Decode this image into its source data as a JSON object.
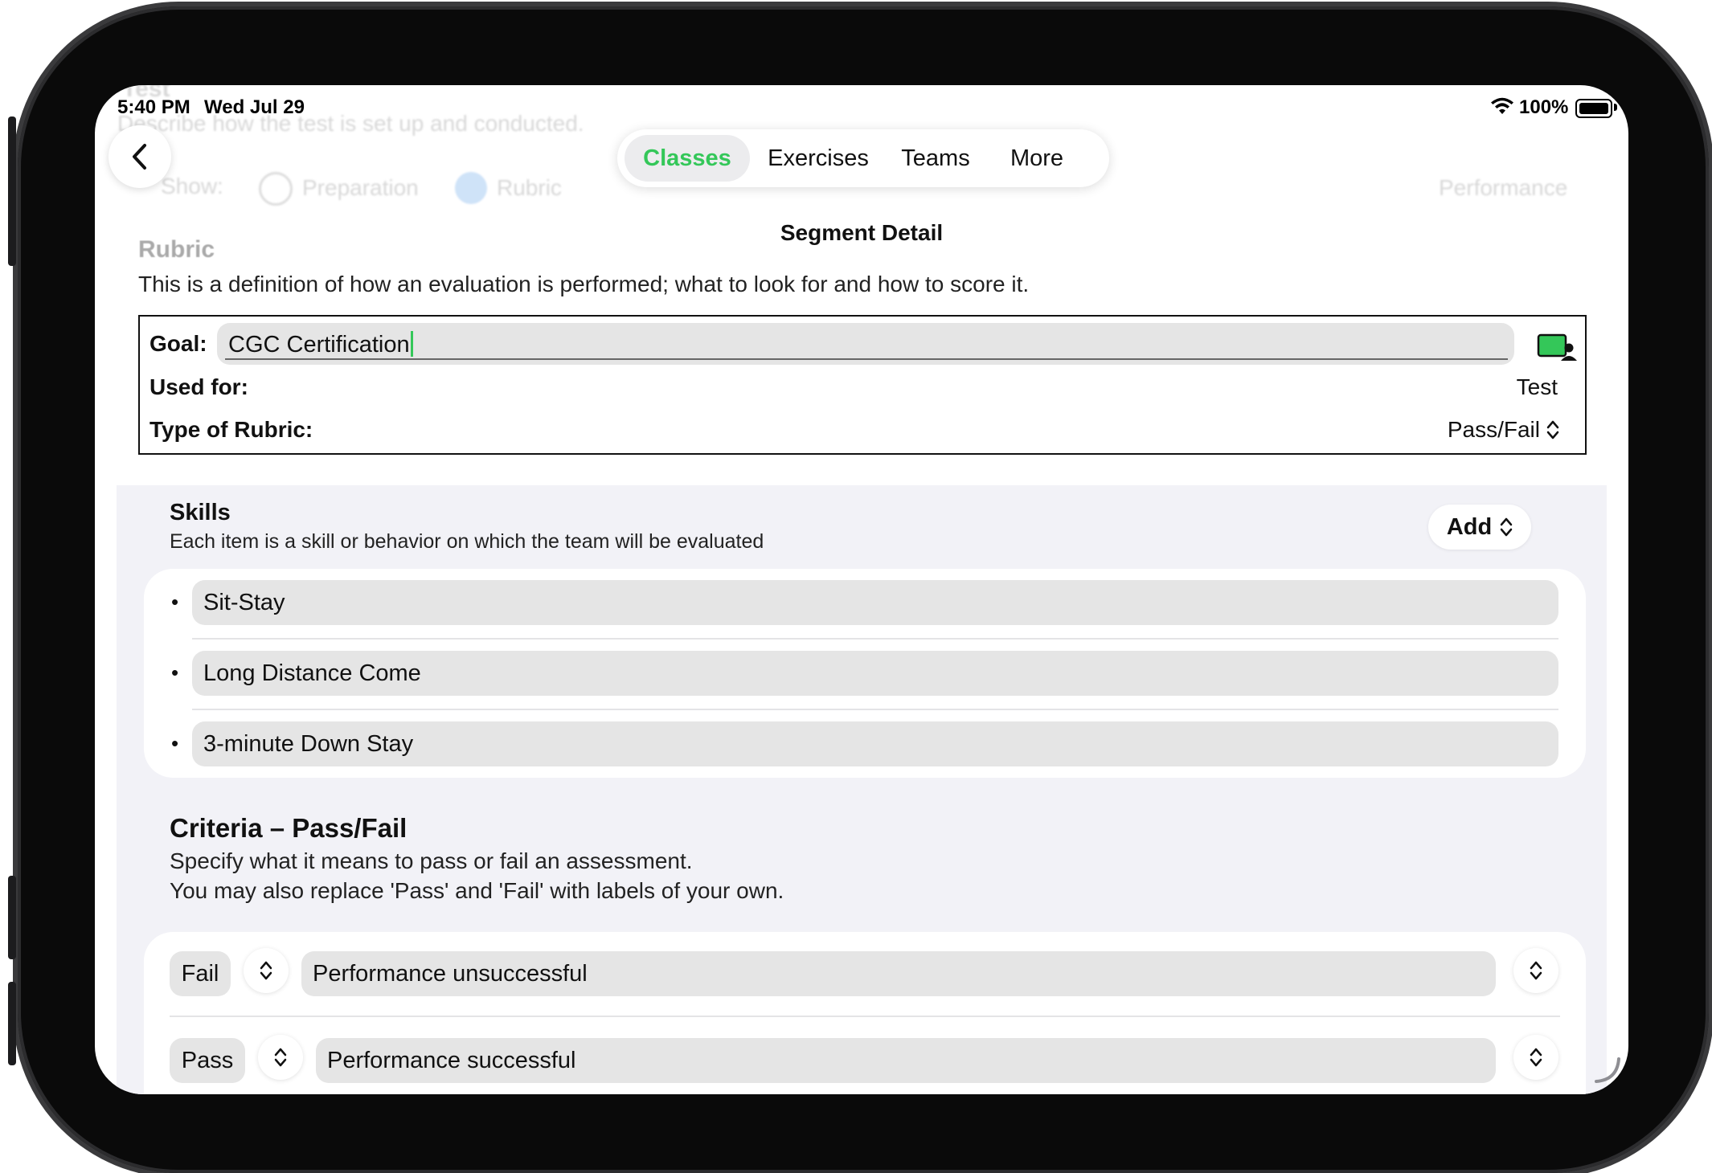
{
  "status_bar": {
    "time": "5:40 PM",
    "date": "Wed Jul 29",
    "battery": "100%",
    "wifi_icon": "wifi-icon",
    "battery_icon": "battery-icon"
  },
  "background_ghost": {
    "heading": "Test",
    "subheading": "Describe how the test is set up and conducted.",
    "show_label": "Show:",
    "option_preparation": "Preparation",
    "option_rubric": "Rubric",
    "performance_label": "Performance",
    "rubric_heading": "Rubric"
  },
  "nav": {
    "back_icon": "chevron-left-icon",
    "title": "Segment Detail",
    "tabs": [
      {
        "label": "Classes",
        "selected": true
      },
      {
        "label": "Exercises",
        "selected": false
      },
      {
        "label": "Teams",
        "selected": false
      },
      {
        "label": "More",
        "selected": false
      }
    ],
    "accent_color": "#34c759"
  },
  "rubric": {
    "description": "This is a definition of how an evaluation is performed; what to look for and how to score it.",
    "goal_label": "Goal:",
    "goal_value": "CGC Certification",
    "goal_icon": "person-card-icon",
    "used_for_label": "Used for:",
    "used_for_value": "Test",
    "type_label": "Type of Rubric:",
    "type_value": "Pass/Fail"
  },
  "skills": {
    "title": "Skills",
    "subtitle": "Each item is a skill or behavior on which the team will be evaluated",
    "add_label": "Add",
    "items": [
      "Sit-Stay",
      "Long Distance Come",
      "3-minute Down Stay"
    ]
  },
  "criteria": {
    "title": "Criteria – Pass/Fail",
    "line1": "Specify what it means to pass or fail an assessment.",
    "line2": "You may also replace 'Pass' and 'Fail' with labels of your own.",
    "rows": [
      {
        "label": "Fail",
        "description": "Performance unsuccessful"
      },
      {
        "label": "Pass",
        "description": "Performance successful"
      }
    ]
  }
}
